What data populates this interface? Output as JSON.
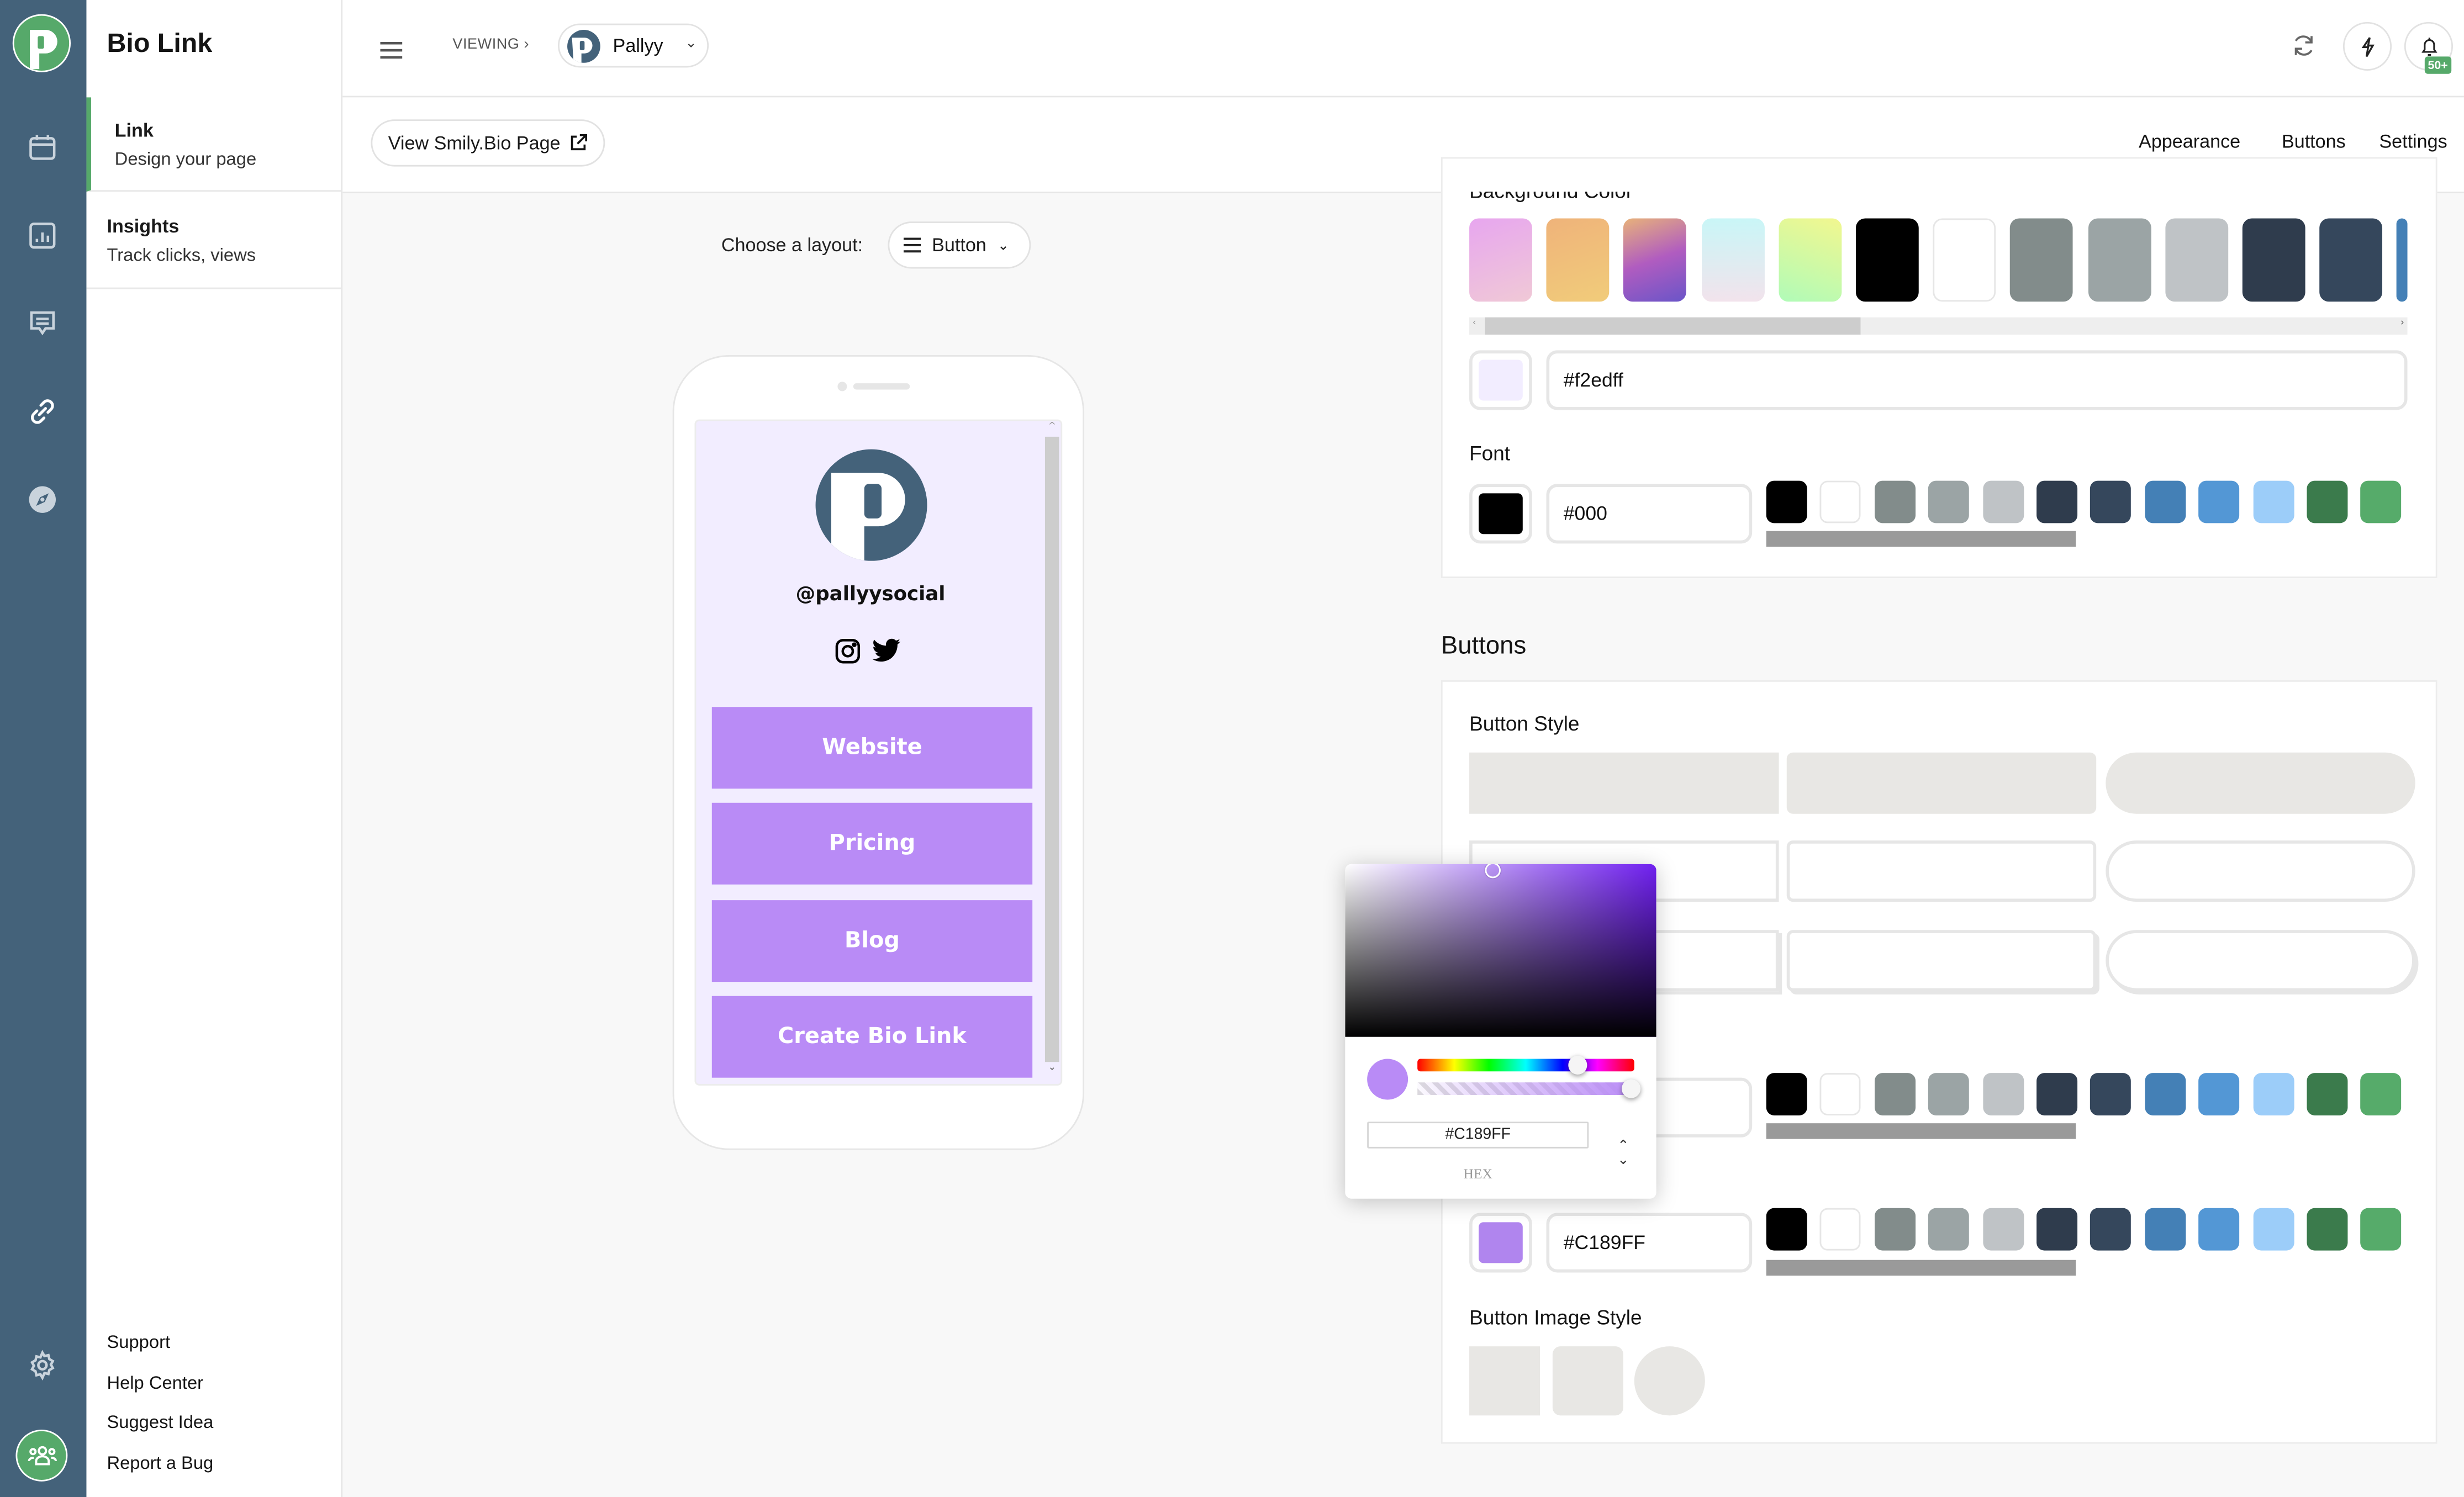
{
  "app": {
    "brand_color": "#56a96a",
    "rail_color": "#44627a",
    "title": "Bio Link"
  },
  "rail": {
    "icons": [
      "logo-icon",
      "calendar-icon",
      "insights-icon",
      "messages-icon",
      "link-icon",
      "compass-icon",
      "gear-icon",
      "team-icon"
    ]
  },
  "sidebar": {
    "items": [
      {
        "title": "Link",
        "subtitle": "Design your page",
        "active": true
      },
      {
        "title": "Insights",
        "subtitle": "Track clicks, views",
        "active": false
      }
    ],
    "footer_links": [
      "Support",
      "Help Center",
      "Suggest Idea",
      "Report a Bug"
    ]
  },
  "header": {
    "viewing_label": "VIEWING ›",
    "account_name": "Pallyy",
    "notification_badge": "50+"
  },
  "toolbar": {
    "view_page_label": "View Smily.Bio Page",
    "tabs": [
      {
        "label": "Appearance",
        "active": true
      },
      {
        "label": "Buttons",
        "active": false
      },
      {
        "label": "Settings",
        "active": false
      }
    ]
  },
  "layout_chooser": {
    "label": "Choose a layout:",
    "selected": "Button"
  },
  "preview": {
    "background": "#f2edff",
    "handle": "@pallyysocial",
    "social_icons": [
      "instagram-icon",
      "twitter-icon"
    ],
    "button_color": "#b98bf6",
    "links": [
      "Website",
      "Pricing",
      "Blog",
      "Create Bio Link"
    ]
  },
  "appearance": {
    "background_label": "Background Color",
    "background_swatches": [
      "linear-gradient(160deg,#e7a6ef,#f0c9d6)",
      "linear-gradient(160deg,#efb37a,#f1cc7a)",
      "linear-gradient(160deg,#e8b27a,#b05cc0,#6a55c8)",
      "linear-gradient(180deg,#c9f6f7,#f2e3ec)",
      "linear-gradient(200deg,#f2f78f,#b0fbb8)",
      "#000000",
      "#ffffff",
      "#828c8b",
      "#9ba4a5",
      "#bfc3c6",
      "#2f3c4d",
      "#35475c",
      "#4480b6"
    ],
    "background_value": "#f2edff",
    "font_label": "Font",
    "font_value": "#000",
    "font_color": "#000000",
    "palette": [
      "#000000",
      "#ffffff",
      "#828c8b",
      "#9ba4a5",
      "#bfc3c6",
      "#2f3c4d",
      "#35475c",
      "#4480b6",
      "#5397d5",
      "#9ccdf9",
      "#3b7b4c",
      "#56ab6a"
    ]
  },
  "buttons": {
    "section_title": "Buttons",
    "style_label": "Button Style",
    "button_color_value": "#C189FF",
    "button_color_swatch": "#b085ee",
    "image_style_label": "Button Image Style"
  },
  "color_picker": {
    "hex_value": "#C189FF",
    "mode_label": "HEX",
    "preview_color": "#b98bf6",
    "alpha": 1.0
  }
}
